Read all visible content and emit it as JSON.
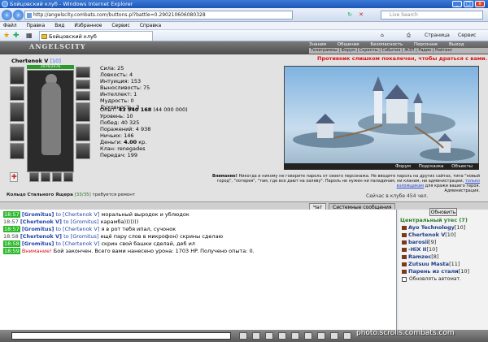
{
  "window": {
    "title": "Бойцовский клуб - Windows Internet Explorer"
  },
  "addressbar": {
    "url": "http://angelscity.combats.com/buttons.pl?battle=0.290210606080328",
    "search_placeholder": "Live Search"
  },
  "menu": [
    "Файл",
    "Правка",
    "Вид",
    "Избранное",
    "Сервис",
    "Справка"
  ],
  "tabbar": {
    "tab_title": "Бойцовский клуб",
    "page_label": "Страница",
    "service_label": "Сервис"
  },
  "game": {
    "logo": "ANGELSCITY",
    "nav": [
      "Знания",
      "Общение",
      "Безопасность",
      "Персонаж",
      "Выход"
    ],
    "links": "Телеграммы | Форум | Скрепты | События | ЖЗП | Радио | Рейтинг",
    "character": {
      "name": "Chertenok V",
      "level": "[10]",
      "hp": "2076/2076"
    },
    "stats": [
      "Сила: 25",
      "Ловкость: 4",
      "Интуиция: 153",
      "Выносливость: 75",
      "Интеллект: 1",
      "Мудрость: 0",
      "Духовность: 3"
    ],
    "exp_label": "Опыт:",
    "exp_value": "43 940 168",
    "exp_next": "(44 000 000)",
    "stats2": [
      "Уровень: 10",
      "Побед: 40 325",
      "Поражений: 4 938",
      "Ничьих: 146"
    ],
    "money_label": "Деньги:",
    "money_value": "4.00",
    "money_unit": "кр.",
    "stats3": [
      "Клан: renegades",
      "Передач: 199"
    ],
    "ring": {
      "text": "Кольцо Стального Ящера",
      "durability": "[33/35]",
      "note": "требуется ремонт"
    },
    "warning": "Противник слишком покалечен, чтобы драться с вами.",
    "scene_links": [
      "Форум",
      "Подсказка",
      "Объекты"
    ],
    "attention": {
      "label": "Внимание!",
      "text": "Никогда и никому не говорите пароль от своего персонажа. Не вводите пароль на других сайтах, типа \"новый город\", \"лотерея\", \"там, где все дают на халяву\". Пароль не нужен ни паладинам, ни кланам, ни администрации,",
      "link": "только взломщикам",
      "tail": "для кражи вашего героя.",
      "sign": "Администрация."
    },
    "online": "Сейчас в клубе 454 чел."
  },
  "chat": {
    "tabs": [
      "Чат",
      "Системные сообщения"
    ],
    "messages": [
      {
        "time": "18:57",
        "from": "[Gromitus]",
        "to": "to [Chertenok V]",
        "text": "моральный выродок и ублюдок",
        "hl": true
      },
      {
        "time": "18:57",
        "from": "[Chertenok V]",
        "to": "to [Gromitus]",
        "text": "карамба)))))))",
        "hl": false
      },
      {
        "time": "18:57",
        "from": "[Gromitus]",
        "to": "to [Chertenok V]",
        "text": "я в рот тебя ипал, сучонок",
        "hl": true
      },
      {
        "time": "18:58",
        "from": "[Chertenok V]",
        "to": "to [Gromitus]",
        "text": "ещё пару слов в микрофон) скрины сделаю",
        "hl": false
      },
      {
        "time": "18:58",
        "from": "[Gromitus]",
        "to": "to [Chertenok V]",
        "text": "скрин свой башки сделай, деб ил",
        "hl": true
      },
      {
        "time": "18:59",
        "from": "Внимание!",
        "to": "",
        "text": "Бой закончен. Всего вами нанесено урона: 1703 HP. Получено опыта: 0.",
        "hl": true
      }
    ]
  },
  "room": {
    "refresh": "Обновить",
    "title": "Центральный утес (7)",
    "users": [
      {
        "name": "Ayo Technology",
        "level": "[10]"
      },
      {
        "name": "Chertenok V",
        "level": "[10]"
      },
      {
        "name": "barosii",
        "level": "[9]"
      },
      {
        "name": "-HiX II",
        "level": "[10]"
      },
      {
        "name": "Ramzec",
        "level": "[8]"
      },
      {
        "name": "Zutsuu Masta",
        "level": "[11]"
      },
      {
        "name": "Парень из стали",
        "level": "[10]"
      }
    ],
    "auto": "Обновлять автомат."
  },
  "watermark": "photo.scrolls.combats.com",
  "colors": {
    "titlebar": "#1f56b8",
    "hp": "#2d9a2d",
    "warn": "#dd1111",
    "name": "#2244aa",
    "room": "#2a7a2a"
  }
}
